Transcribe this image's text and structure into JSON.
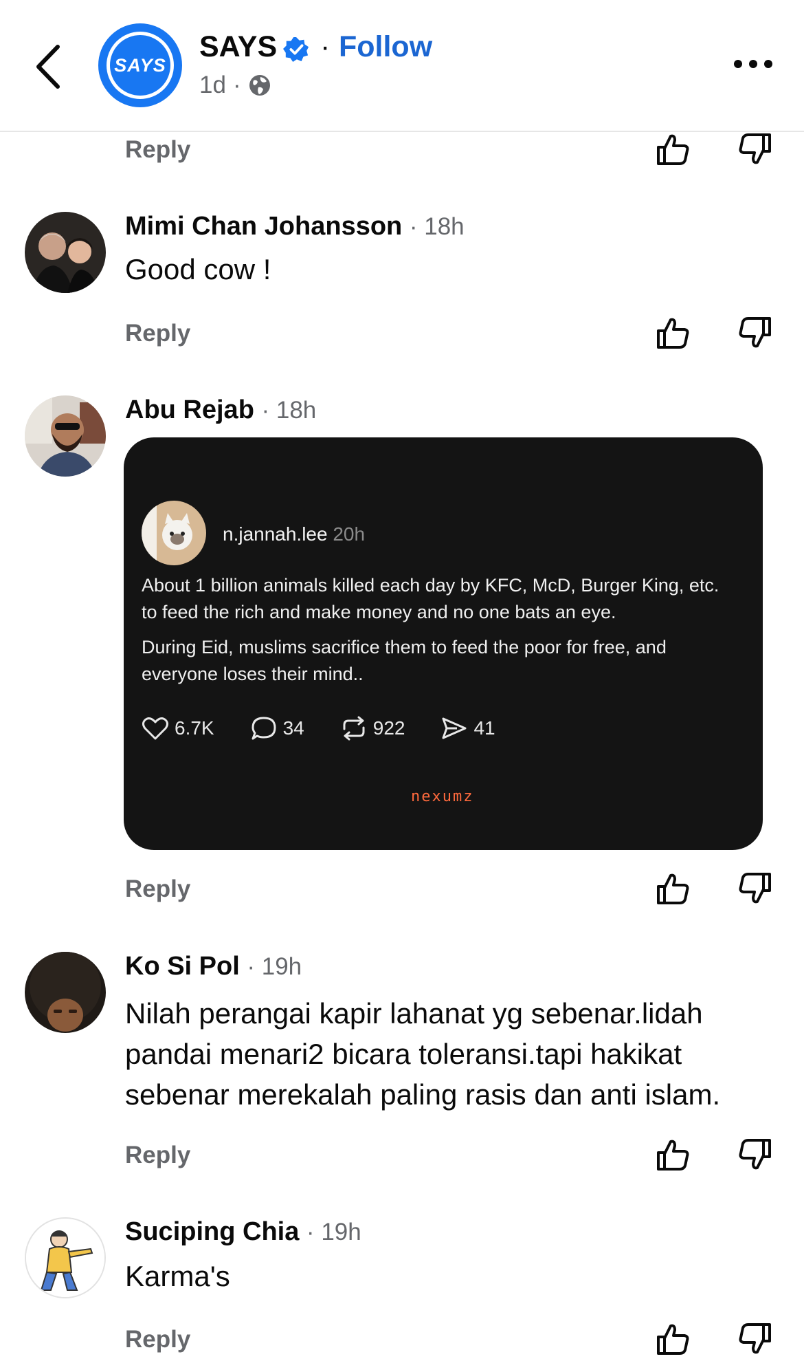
{
  "header": {
    "page_name": "SAYS",
    "logo_text": "SAYS",
    "follow_label": "Follow",
    "separator": "·",
    "time": "1d",
    "time_sep": "·"
  },
  "reply_label": "Reply",
  "comments": [
    {
      "author": "Mimi Chan Johansson",
      "time": "18h",
      "text": "Good cow !"
    },
    {
      "author": "Abu Rejab",
      "time": "18h",
      "text": "",
      "attachment": {
        "username": "n.jannah.lee",
        "time": "20h",
        "para1": "About 1 billion animals killed each day by KFC, McD, Burger King, etc. to feed the rich and make money and no one bats an eye.",
        "para2": "During Eid, muslims sacrifice them to feed the poor for free, and everyone loses their mind..",
        "likes": "6.7K",
        "comments": "34",
        "reposts": "922",
        "shares": "41",
        "watermark": "nexumz"
      }
    },
    {
      "author": "Ko Si Pol",
      "time": "19h",
      "text_lines": [
        "Nilah perangai kapir lahanat yg sebenar.lidah",
        "pandai menari2 bicara toleransi.tapi hakikat",
        "sebenar merekalah paling rasis dan anti islam."
      ]
    },
    {
      "author": "Suciping Chia",
      "time": "19h",
      "text": "Karma's"
    }
  ],
  "colors": {
    "accent": "#1b66d2",
    "brand": "#1877f2",
    "muted": "#65676b",
    "dark_card": "#141414"
  }
}
